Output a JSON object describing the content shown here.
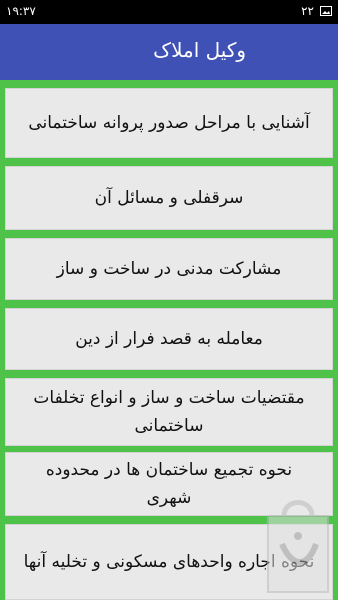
{
  "status_bar": {
    "time": "۱۹:۳۷",
    "notification_count": "۲۲",
    "left_icon": "image-icon"
  },
  "app_bar": {
    "title": "وکیل املاک"
  },
  "menu": {
    "items": [
      "آشنایی با مراحل صدور پروانه ساختمانی",
      "سرقفلی و مسائل آن",
      "مشارکت مدنی در ساخت و ساز",
      "معامله به قصد فرار از دین",
      "مقتضیات ساخت و ساز و انواع تخلفات ساختمانی",
      "نحوه تجمیع ساختمان ها در محدوده شهری",
      "نحوه اجاره واحدهای مسکونی و تخلیه آنها"
    ]
  },
  "colors": {
    "background": "#4fc24a",
    "app_bar": "#3f51b5",
    "item_bg": "#e9e9e9"
  }
}
